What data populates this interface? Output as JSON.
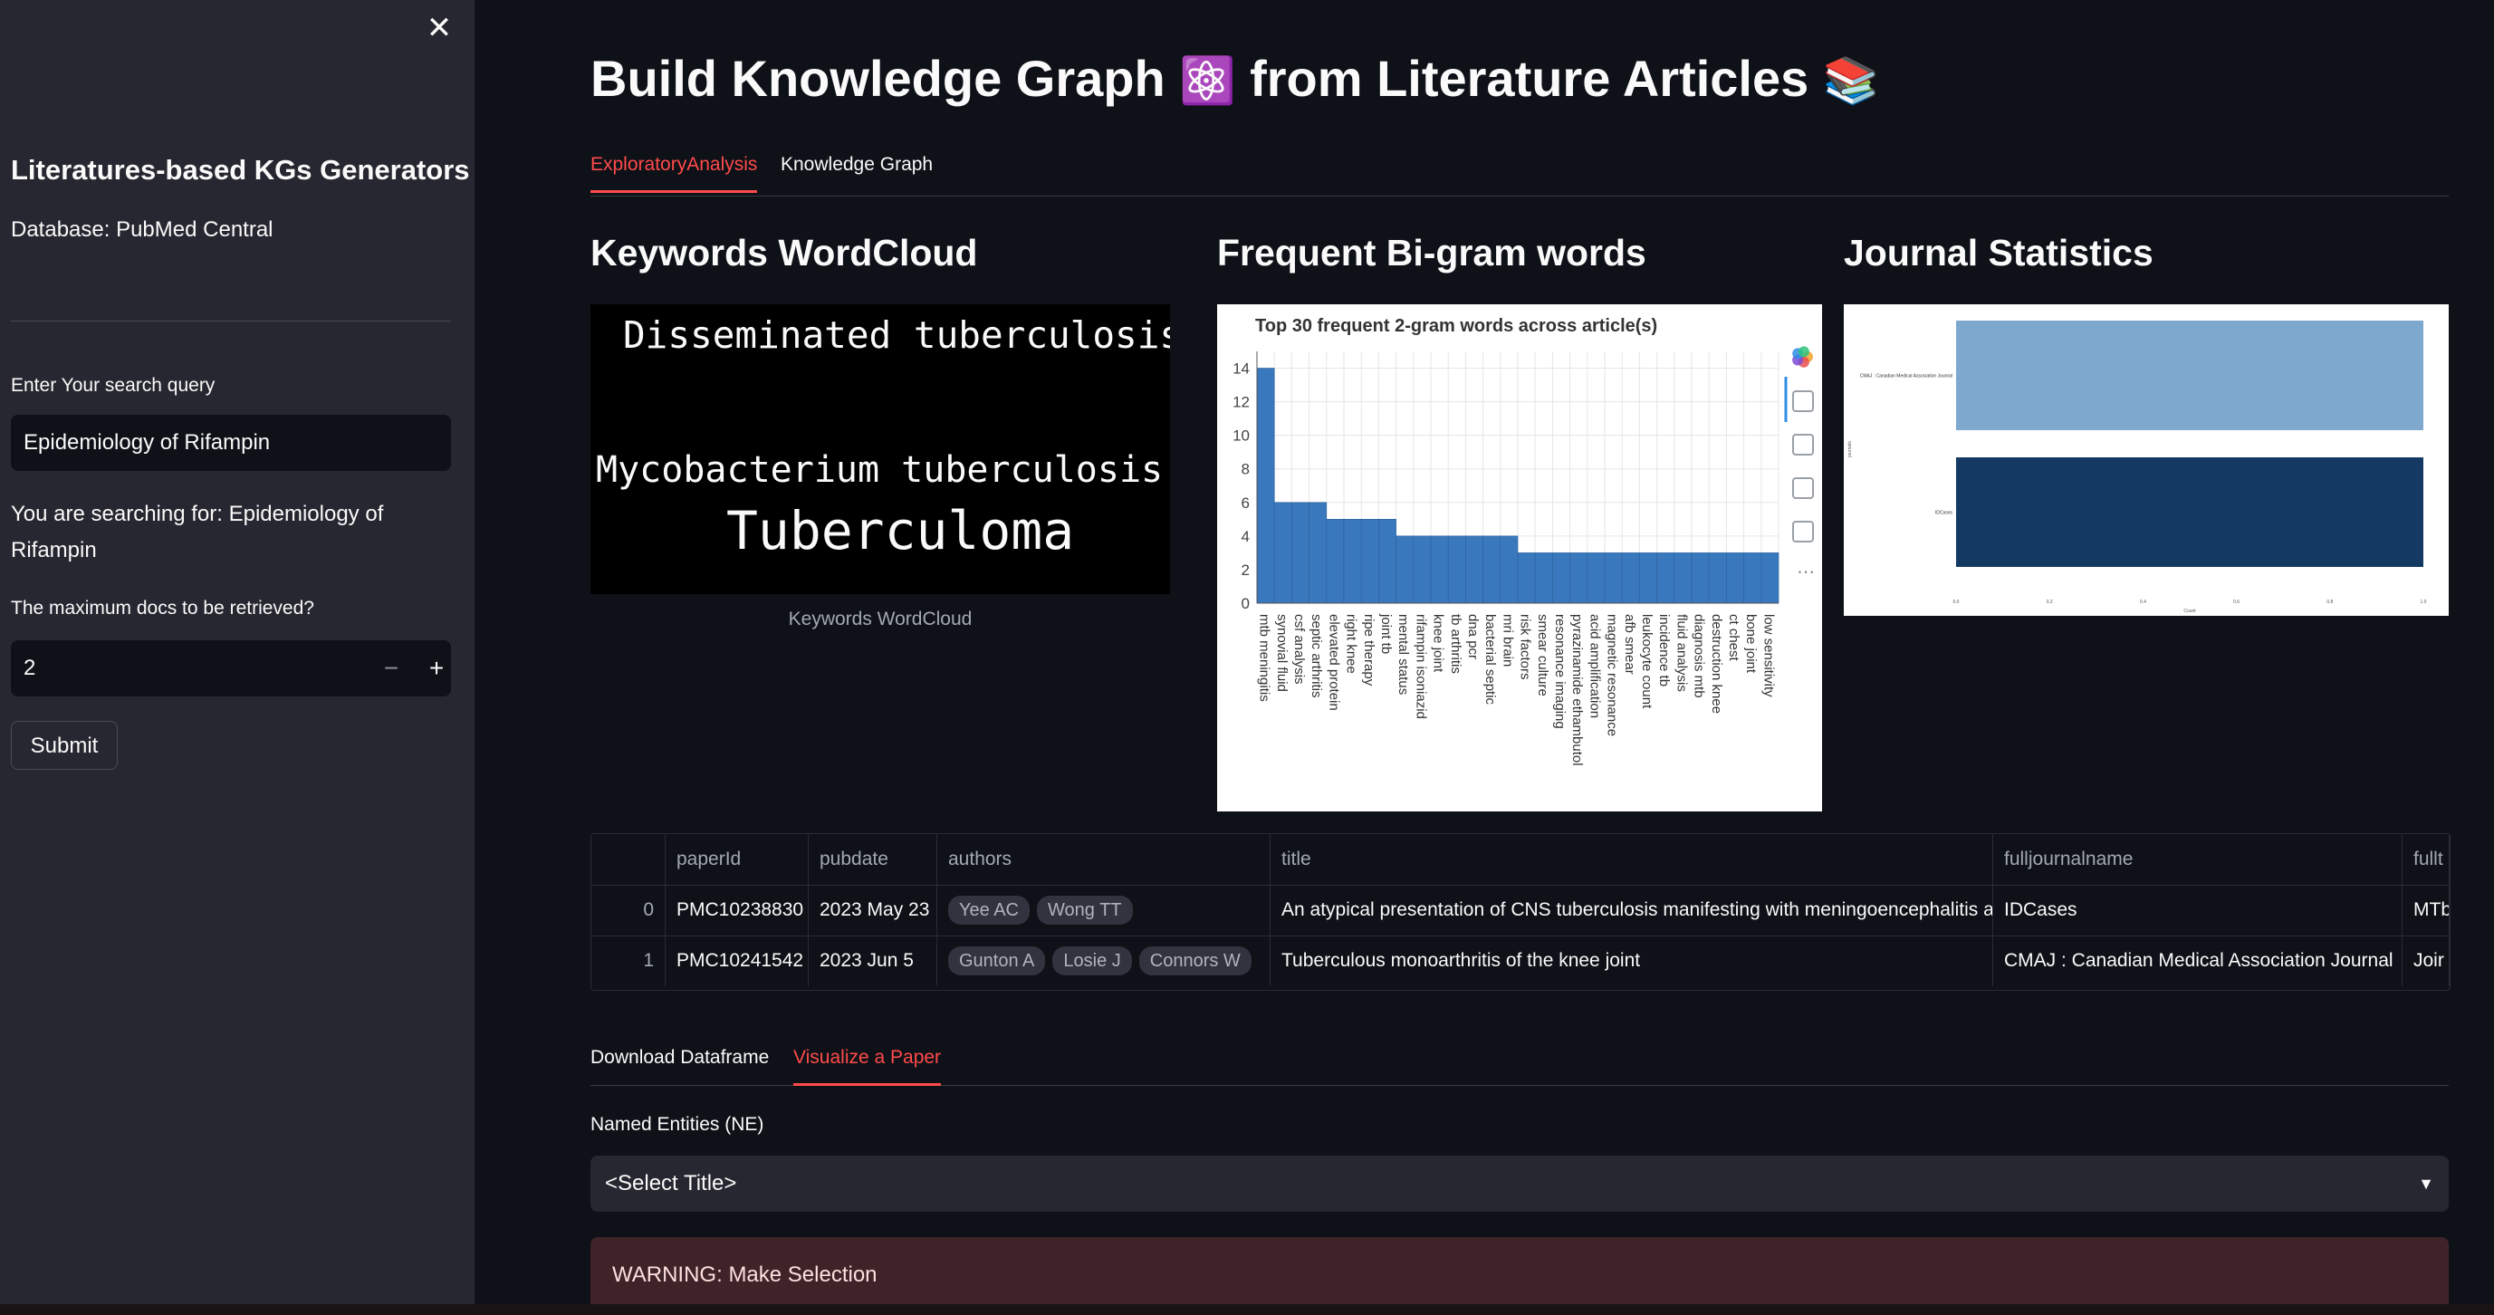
{
  "sidebar": {
    "close_icon": "✕",
    "title": "Literatures-based KGs Generators",
    "database": "Database: PubMed Central",
    "search_label": "Enter Your search query",
    "search_value": "Epidemiology of Rifampin",
    "searching_for": "You are searching for: Epidemiology of Rifampin",
    "max_docs_label": "The maximum docs to be retrieved?",
    "max_docs_value": "2",
    "minus": "−",
    "plus": "+",
    "submit_label": "Submit"
  },
  "main": {
    "title_part1": "Build Knowledge Graph",
    "title_emoji1": "⚛️",
    "title_part2": "from Literature Articles",
    "title_emoji2": "📚",
    "tabs": [
      {
        "label": "ExploratoryAnalysis",
        "active": true
      },
      {
        "label": "Knowledge Graph",
        "active": false
      }
    ],
    "sections": {
      "wordcloud": "Keywords WordCloud",
      "bigram": "Frequent Bi-gram words",
      "journal": "Journal Statistics"
    },
    "wordcloud_words": [
      {
        "text": "Disseminated tuberculosis",
        "color": "#7fd9a6"
      },
      {
        "text": "Mycobacterium tuberculosis",
        "color": "#5aa6a3"
      },
      {
        "text": "Tuberculoma",
        "color": "#c9e06b"
      }
    ],
    "wordcloud_caption": "Keywords WordCloud"
  },
  "chart_data": [
    {
      "type": "bar",
      "title": "Top 30 frequent 2-gram words across article(s)",
      "categories": [
        "mtb meningitis",
        "synovial fluid",
        "csf analysis",
        "septic arthritis",
        "elevated protein",
        "right knee",
        "ripe therapy",
        "joint tb",
        "mental status",
        "rifampin isoniazid",
        "knee joint",
        "tb arthritis",
        "dna pcr",
        "bacterial septic",
        "mri brain",
        "risk factors",
        "smear culture",
        "resonance imaging",
        "pyrazinamide ethambutol",
        "acid amplification",
        "magnetic resonance",
        "afb smear",
        "leukocyte count",
        "incidence tb",
        "fluid analysis",
        "diagnosis mtb",
        "destruction knee",
        "ct chest",
        "bone joint",
        "low sensitivity"
      ],
      "values": [
        14,
        6,
        6,
        6,
        5,
        5,
        5,
        5,
        4,
        4,
        4,
        4,
        4,
        4,
        4,
        3,
        3,
        3,
        3,
        3,
        3,
        3,
        3,
        3,
        3,
        3,
        3,
        3,
        3,
        3
      ],
      "ylim": [
        0,
        15
      ],
      "yticks": [
        0,
        2,
        4,
        6,
        8,
        10,
        12,
        14
      ],
      "grid": true,
      "color": "#3a78bd",
      "toolbar_icons": [
        "bokeh-logo-icon",
        "pan-icon",
        "box-zoom-icon",
        "wheel-zoom-icon",
        "save-icon",
        "more-icon"
      ]
    },
    {
      "type": "bar",
      "orientation": "horizontal",
      "categories": [
        "CMAJ : Canadian Medical Association Journal",
        "IDCases"
      ],
      "values": [
        1,
        1
      ],
      "xlim": [
        0,
        1
      ],
      "xticks": [
        "0.0",
        "0.2",
        "0.4",
        "0.6",
        "0.8",
        "1.0"
      ],
      "xlabel": "Count",
      "ylabel": "journals",
      "colors": [
        "#7fa8cf",
        "#143a63"
      ]
    }
  ],
  "table": {
    "columns": [
      "",
      "paperId",
      "pubdate",
      "authors",
      "title",
      "fulljournalname",
      "fullt"
    ],
    "rows": [
      {
        "index": "0",
        "paperId": "PMC10238830",
        "pubdate": "2023 May 23",
        "authors": [
          "Yee AC",
          "Wong TT"
        ],
        "title": "An atypical presentation of CNS tuberculosis manifesting with meningoencephalitis a",
        "journal": "IDCases",
        "fullt": "MTb"
      },
      {
        "index": "1",
        "paperId": "PMC10241542",
        "pubdate": "2023 Jun 5",
        "authors": [
          "Gunton A",
          "Losie J",
          "Connors W"
        ],
        "title": "Tuberculous monoarthritis of the knee joint",
        "journal": "CMAJ : Canadian Medical Association Journal",
        "fullt": "Joir"
      }
    ]
  },
  "bottom": {
    "tabs": [
      {
        "label": "Download Dataframe",
        "active": false
      },
      {
        "label": "Visualize a Paper",
        "active": true
      }
    ],
    "ne_label": "Named Entities (NE)",
    "select_value": "<Select Title>",
    "warning": "WARNING: Make Selection"
  }
}
